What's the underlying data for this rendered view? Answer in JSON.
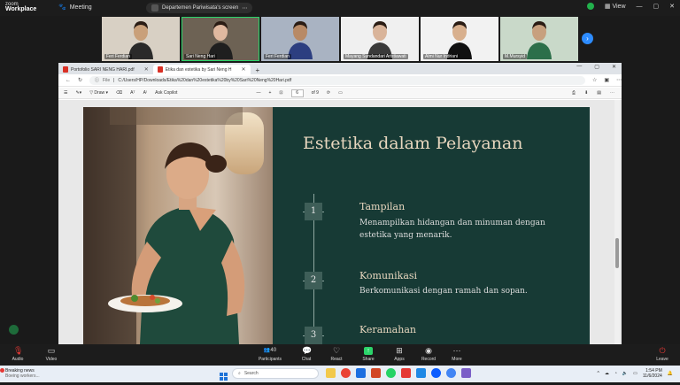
{
  "zoom": {
    "logo_top": "zoom",
    "logo_bottom": "Workplace",
    "meeting_label": "Meeting",
    "share_label": "Departemen Pariwisata's screen",
    "view_label": "View"
  },
  "participants": [
    {
      "name": "Feri Ferdian",
      "active": false,
      "skin": "#c9a07a",
      "shirt": "#2a2a2a",
      "bg": "#d8d0c4"
    },
    {
      "name": "Sari Neng Hari",
      "active": true,
      "skin": "#e0b9a0",
      "shirt": "#1f1f1f",
      "bg": "#6d6254"
    },
    {
      "name": "Feri Ferdian",
      "active": false,
      "skin": "#b88a66",
      "shirt": "#2c3e80",
      "bg": "#a9b3c2"
    },
    {
      "name": "Mayang Sundandari Aristiawati",
      "active": false,
      "skin": "#d9b49a",
      "shirt": "#3a3a3a",
      "bg": "#f0f0f0"
    },
    {
      "name": "Almi Nur Indriani",
      "active": false,
      "skin": "#d8b08e",
      "shirt": "#111111",
      "bg": "#f2f2f2"
    },
    {
      "name": "M.Mursyid",
      "active": false,
      "skin": "#c7a07e",
      "shirt": "#2c6f4a",
      "bg": "#c9d9c9"
    }
  ],
  "browser": {
    "tabs": [
      {
        "label": "Portofolio SARI NENG HARI.pdf",
        "active": false
      },
      {
        "label": "Etika dan estetika by Sari Neng H",
        "active": true
      }
    ],
    "address_prefix": "File",
    "url": "C:/Users/HP/Downloads/Etika%20dan%20estetika%20by%20Sari%20Neng%20Hari.pdf",
    "pdf_toolbar": {
      "draw_label": "Draw",
      "page_current": "6",
      "page_total": "of 9",
      "copilot_label": "Ask Copilot"
    }
  },
  "slide": {
    "title": "Estetika dalam Pelayanan",
    "items": [
      {
        "number": "1",
        "title": "Tampilan",
        "desc": "Menampilkan hidangan dan minuman dengan estetika yang menarik."
      },
      {
        "number": "2",
        "title": "Komunikasi",
        "desc": "Berkomunikasi dengan ramah dan sopan."
      },
      {
        "number": "3",
        "title": "Keramahan",
        "desc": ""
      }
    ]
  },
  "controls": {
    "audio": "Audio",
    "video": "Video",
    "participants": "Participants",
    "participants_count": "40",
    "chat": "Chat",
    "react": "React",
    "share": "Share",
    "apps": "Apps",
    "record": "Record",
    "more": "More",
    "leave": "Leave"
  },
  "taskbar": {
    "news_title": "Breaking news",
    "news_sub": "Boeing workers...",
    "search_placeholder": "Search",
    "time": "1:54 PM",
    "date": "11/6/2024"
  },
  "colors": {
    "slide_panel": "#173a35",
    "slide_accent": "#e8d7bf",
    "zoom_share_green": "#2bd46a",
    "zoom_blue": "#2d8cff"
  }
}
